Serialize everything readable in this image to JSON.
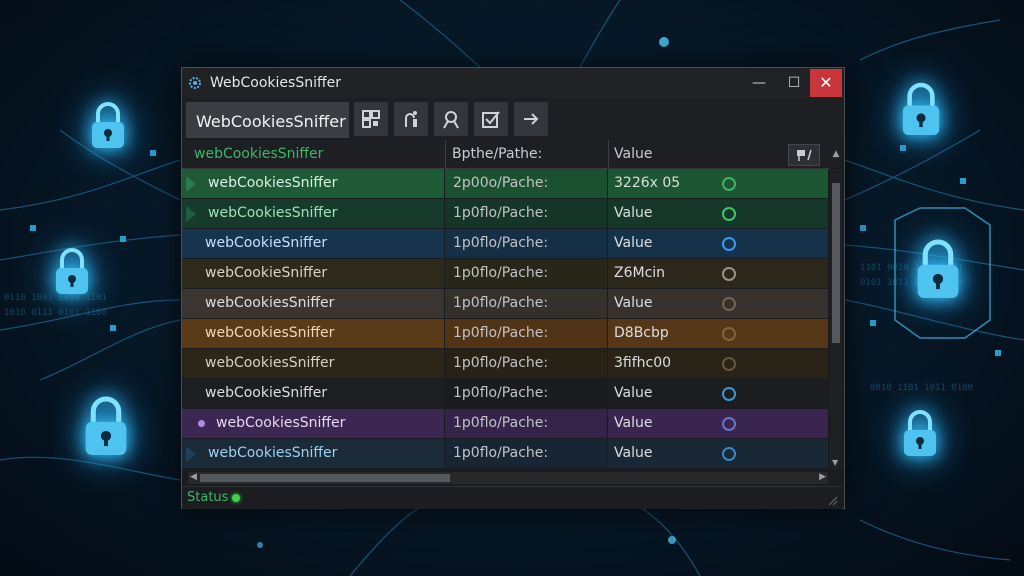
{
  "window": {
    "title": "WebCookiesSniffer",
    "minimize": "—",
    "maximize": "☐",
    "close": "✕"
  },
  "toolbar": {
    "active_tab": "WebCookiesSniffer",
    "buttons": [
      {
        "icon": "grid-icon"
      },
      {
        "icon": "tool-icon"
      },
      {
        "icon": "user-icon"
      },
      {
        "icon": "checkbox-icon"
      },
      {
        "icon": "arrow-right-icon"
      }
    ]
  },
  "columns": {
    "name": "webCookiesSniffer",
    "path": "Bpthe/Pathe:",
    "value": "Value"
  },
  "rows": [
    {
      "name": "webCookiesSniffer",
      "path": "2p00o/Pache:",
      "value": "3226x 05",
      "bg": "#1e5a35",
      "name_color": "#d9f0e0",
      "dot_color": "#3fbf6a",
      "marker": "arrow",
      "marker_color": "#2f7a4a"
    },
    {
      "name": "webCookiesSniffer",
      "path": "1p0flo/Pache:",
      "value": "Value",
      "bg": "#163b2c",
      "name_color": "#9fe0b8",
      "dot_color": "#3fd36a",
      "marker": "arrow",
      "marker_color": "#245c40"
    },
    {
      "name": "webCookieSniffer",
      "path": "1p0flo/Pache:",
      "value": "Value",
      "bg": "#17344e",
      "name_color": "#bfe0ff",
      "dot_color": "#3aa0ff",
      "marker": "none",
      "marker_color": ""
    },
    {
      "name": "webCookieSniffer",
      "path": "1p0flo/Pache:",
      "value": "Z6Mcin",
      "bg": "#2d2a1c",
      "name_color": "#d8d4c4",
      "dot_color": "#9c9a90",
      "marker": "none",
      "marker_color": ""
    },
    {
      "name": "webCookiesSniffer",
      "path": "1p0flo/Pache:",
      "value": "Value",
      "bg": "#3a3530",
      "name_color": "#e0dcd6",
      "dot_color": "#7a6a55",
      "marker": "none",
      "marker_color": ""
    },
    {
      "name": "webCookiesSniffer",
      "path": "1p0flo/Pache:",
      "value": "D8Bcbp",
      "bg": "#5a3a18",
      "name_color": "#f0d8b8",
      "dot_color": "#8a6a3a",
      "marker": "none",
      "marker_color": ""
    },
    {
      "name": "webCookiesSniffer",
      "path": "1p0flo/Pache:",
      "value": "3fifhc00",
      "bg": "#2c2619",
      "name_color": "#d6d0c2",
      "dot_color": "#6a5a3c",
      "marker": "none",
      "marker_color": ""
    },
    {
      "name": "webCookieSniffer",
      "path": "1p0flo/Pache:",
      "value": "Value",
      "bg": "#1c1e21",
      "name_color": "#dcdee2",
      "dot_color": "#3aa0e0",
      "marker": "none",
      "marker_color": ""
    },
    {
      "name": "webCookiesSniffer",
      "path": "1p0flo/Pache:",
      "value": "Value",
      "bg": "#3c2752",
      "name_color": "#e6d8f6",
      "dot_color": "#6a7ad0",
      "marker": "bullet",
      "marker_color": "#b48be0"
    },
    {
      "name": "webCookiesSniffer",
      "path": "1p0flo/Pache:",
      "value": "Value",
      "bg": "#1a2a38",
      "name_color": "#9fd0f0",
      "dot_color": "#3a90d0",
      "marker": "arrow",
      "marker_color": "#1f4058"
    }
  ],
  "status": {
    "label": "Status",
    "indicator_color": "#3fd34a"
  }
}
